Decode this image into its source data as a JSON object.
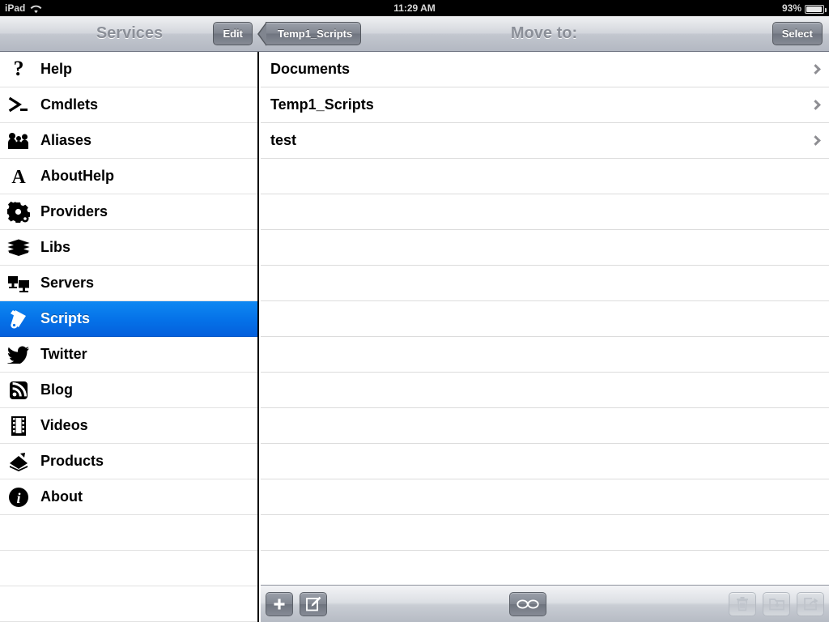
{
  "statusbar": {
    "device": "iPad",
    "wifi_icon": "wifi-icon",
    "time": "11:29 AM",
    "battery_percent": "93%",
    "battery_icon": "battery-icon"
  },
  "sidebar": {
    "navbar": {
      "title": "Services",
      "edit_label": "Edit"
    },
    "selected": "Scripts",
    "items": [
      {
        "label": "Help",
        "icon": "question-mark-icon"
      },
      {
        "label": "Cmdlets",
        "icon": "command-prompt-icon"
      },
      {
        "label": "Aliases",
        "icon": "people-icon"
      },
      {
        "label": "AboutHelp",
        "icon": "letter-a-icon"
      },
      {
        "label": "Providers",
        "icon": "gear-icon"
      },
      {
        "label": "Libs",
        "icon": "books-icon"
      },
      {
        "label": "Servers",
        "icon": "monitors-icon"
      },
      {
        "label": "Scripts",
        "icon": "scroll-icon"
      },
      {
        "label": "Twitter",
        "icon": "twitter-bird-icon"
      },
      {
        "label": "Blog",
        "icon": "rss-feed-icon"
      },
      {
        "label": "Videos",
        "icon": "film-strip-icon"
      },
      {
        "label": "Products",
        "icon": "products-icon"
      },
      {
        "label": "About",
        "icon": "info-icon"
      }
    ]
  },
  "detail": {
    "navbar": {
      "back_label": "Temp1_Scripts",
      "title": "Move to:",
      "select_label": "Select"
    },
    "rows": [
      {
        "label": "Documents",
        "accessory": "chevron-right-icon"
      },
      {
        "label": "Temp1_Scripts",
        "accessory": "chevron-right-icon"
      },
      {
        "label": "test",
        "accessory": "chevron-right-icon"
      }
    ],
    "toolbar": {
      "left_buttons": [
        {
          "name": "add-button",
          "icon": "plus-icon",
          "enabled": true
        },
        {
          "name": "compose-button",
          "icon": "compose-icon",
          "enabled": true
        }
      ],
      "center_buttons": [
        {
          "name": "reader-button",
          "icon": "glasses-icon",
          "enabled": true
        }
      ],
      "right_buttons": [
        {
          "name": "delete-button",
          "icon": "trash-icon",
          "enabled": false
        },
        {
          "name": "move-button",
          "icon": "folder-move-icon",
          "enabled": false
        },
        {
          "name": "share-button",
          "icon": "share-export-icon",
          "enabled": false
        }
      ]
    }
  },
  "colors": {
    "selection_blue": "#0e88f2",
    "navbar_gray": "#c3c7cf",
    "statusbar_black": "#000000",
    "chevron_gray": "#8e8e93"
  }
}
